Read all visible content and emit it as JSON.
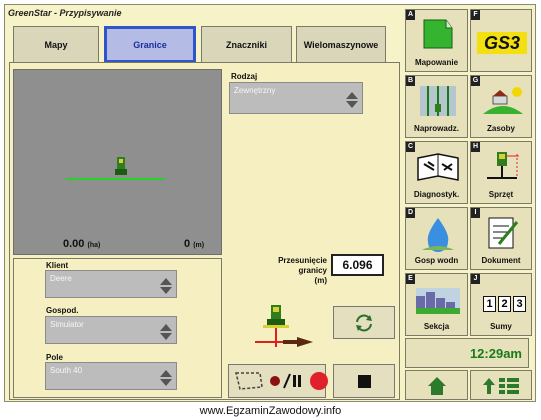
{
  "window": {
    "title": "GreenStar - Przypisywanie"
  },
  "tabs": [
    {
      "label": "Mapy",
      "active": false
    },
    {
      "label": "Granice",
      "active": true
    },
    {
      "label": "Znaczniki",
      "active": false
    },
    {
      "label": "Wielomaszynowe",
      "active": false
    }
  ],
  "map": {
    "area_value": "0.00",
    "area_unit": "(ha)",
    "distance_value": "0",
    "distance_unit": "(m)"
  },
  "rodzaj": {
    "label": "Rodzaj",
    "value": "Zewnętrzny"
  },
  "fields": {
    "klient": {
      "label": "Klient",
      "value": "Deere"
    },
    "gospod": {
      "label": "Gospod.",
      "value": "Simulator"
    },
    "pole": {
      "label": "Pole",
      "value": "South 40"
    }
  },
  "offset": {
    "label_line1": "Przesunięcie",
    "label_line2": "granicy",
    "unit": "(m)",
    "value": "6.096"
  },
  "sidebar": [
    {
      "letter": "A",
      "label": "Mapowanie",
      "icon": "field-map-icon"
    },
    {
      "letter": "F",
      "label": "",
      "icon": "gs3-logo"
    },
    {
      "letter": "B",
      "label": "Naprowadz.",
      "icon": "guidance-icon"
    },
    {
      "letter": "G",
      "label": "Zasoby",
      "icon": "resources-icon"
    },
    {
      "letter": "C",
      "label": "Diagnostyk.",
      "icon": "diagnostics-book-icon"
    },
    {
      "letter": "H",
      "label": "Sprzęt",
      "icon": "equipment-icon"
    },
    {
      "letter": "D",
      "label": "Gosp wodn",
      "icon": "water-drop-icon"
    },
    {
      "letter": "I",
      "label": "Dokument",
      "icon": "document-icon"
    },
    {
      "letter": "E",
      "label": "Sekcja",
      "icon": "section-icon"
    },
    {
      "letter": "J",
      "label": "Sumy",
      "icon": "totals-icon"
    }
  ],
  "sums_digits": [
    "1",
    "2",
    "3"
  ],
  "clock": "12:29am",
  "footer": "www.EgzaminZawodowy.info",
  "colors": {
    "accent_tab": "#2f55c8",
    "boom_line": "#25d12a",
    "record_button": "#e0202a",
    "tractor": "#2f7d1f"
  }
}
